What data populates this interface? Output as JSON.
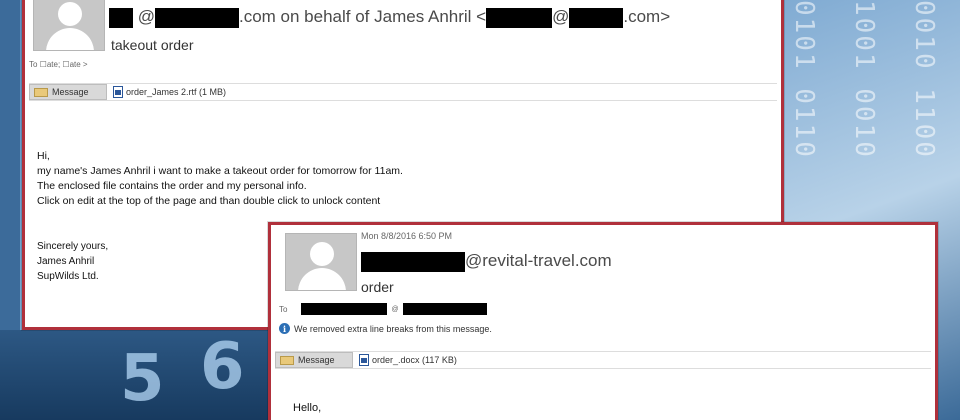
{
  "email1": {
    "from_domain": ".com on behalf of James Anhril <",
    "from_tail": ".com>",
    "subject": "takeout order",
    "to_line": "To    ☐ate;  ☐ate >",
    "attach_button": "Message",
    "attachment": "order_James 2.rtf (1 MB)",
    "body": {
      "greeting": "Hi,",
      "line1": "my name's  James Anhril i want to make a takeout order for tomorrow for 11am.",
      "line2": "The enclosed file contains the order and my personal info.",
      "line3": "Click on edit at the top of the page and than double click  to unlock content",
      "closing": "Sincerely yours,",
      "name": "James Anhril",
      "company": "SupWilds Ltd."
    }
  },
  "email2": {
    "date": "Mon 8/8/2016 6:50 PM",
    "from_domain": "@revital-travel.com",
    "subject": "order",
    "to_label": "To",
    "info": "We removed extra line breaks from this message.",
    "attach_button": "Message",
    "attachment": "order_.docx (117 KB)",
    "greeting": "Hello,"
  },
  "colors": {
    "frame": "#b0303b",
    "redaction": "#000000"
  },
  "background": {
    "digits": "5 6"
  }
}
